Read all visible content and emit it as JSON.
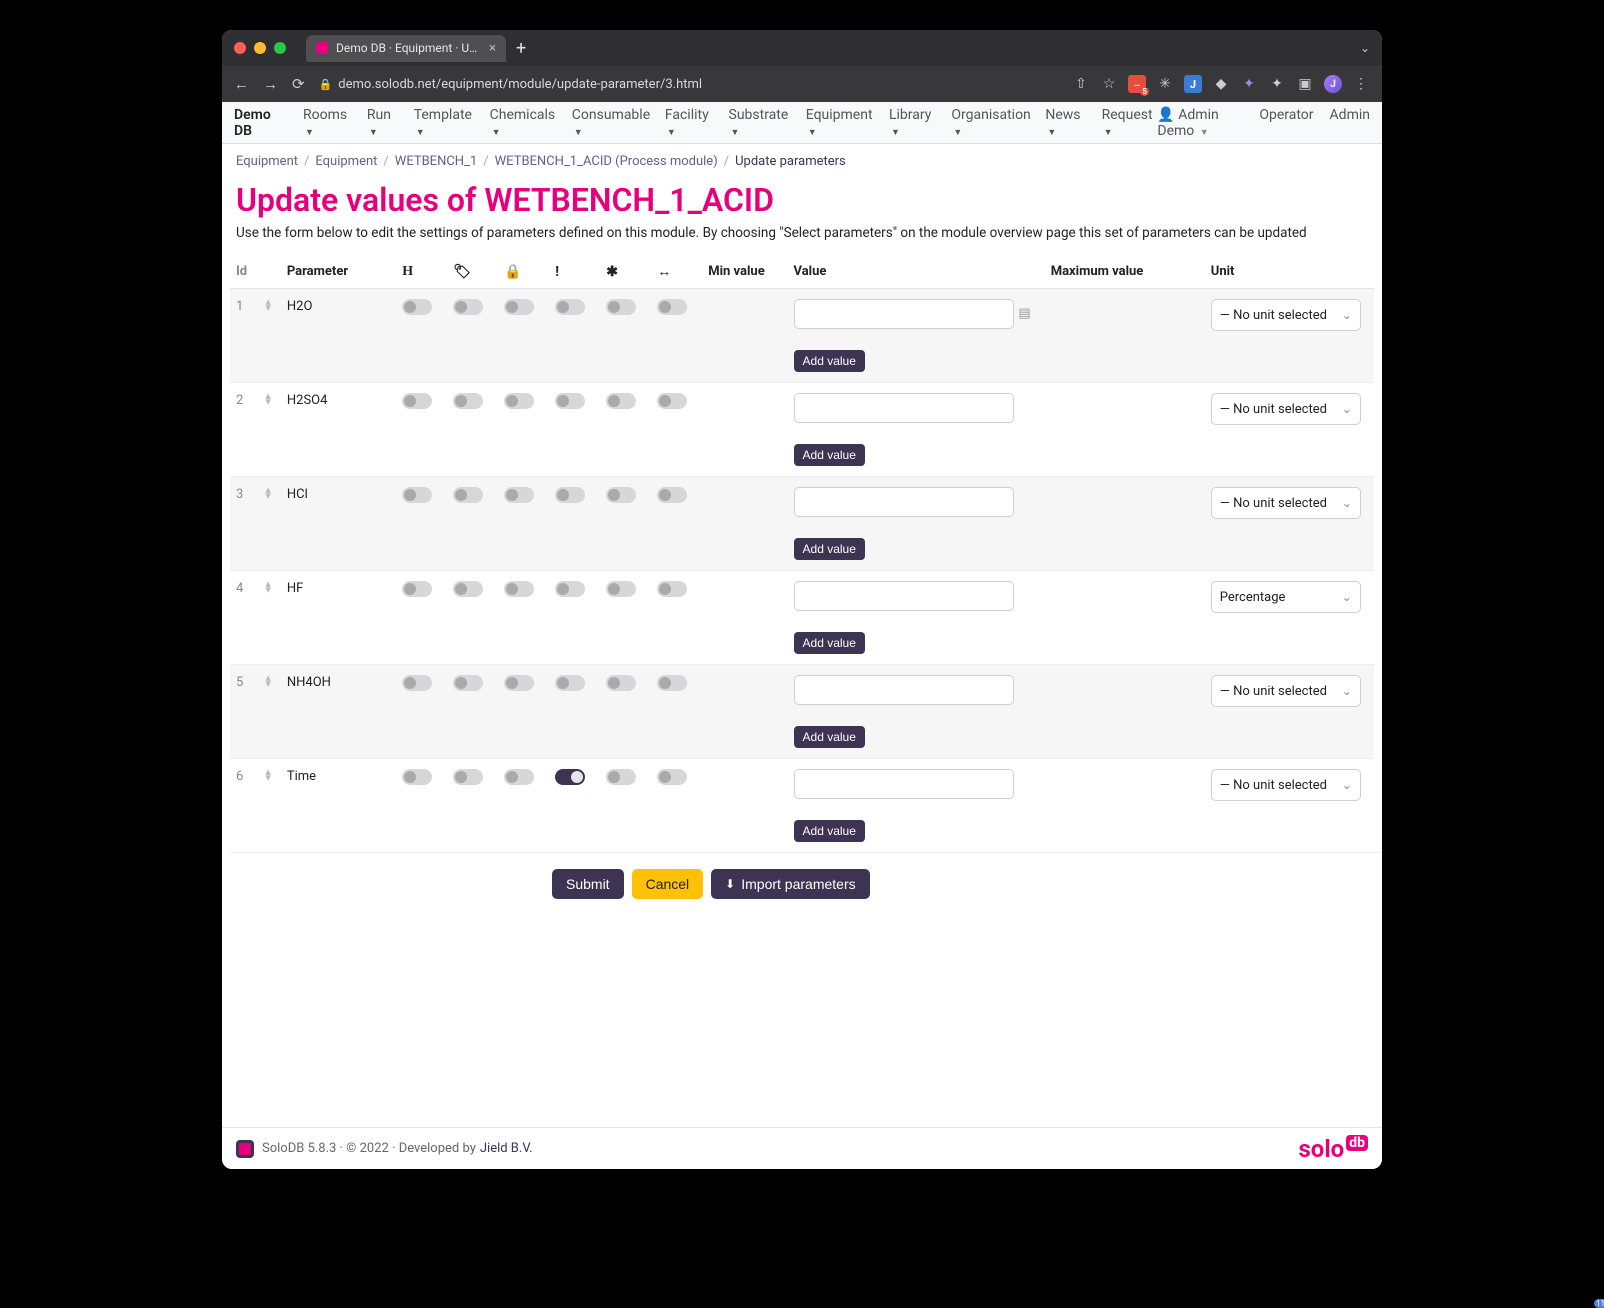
{
  "browser": {
    "tab_title": "Demo DB · Equipment · Update",
    "url": "demo.solodb.net/equipment/module/update-parameter/3.html"
  },
  "nav": {
    "brand": "Demo DB",
    "items": [
      "Rooms",
      "Run",
      "Template",
      "Chemicals",
      "Consumable",
      "Facility",
      "Substrate",
      "Equipment",
      "Library",
      "Organisation",
      "News",
      "Request"
    ],
    "user_label": "Admin Demo",
    "right_links": [
      "Operator",
      "Admin"
    ]
  },
  "breadcrumb": {
    "items": [
      "Equipment",
      "Equipment",
      "WETBENCH_1",
      "WETBENCH_1_ACID (Process module)",
      "Update parameters"
    ]
  },
  "page": {
    "title": "Update values of WETBENCH_1_ACID",
    "description": "Use the form below to edit the settings of parameters defined on this module. By choosing \"Select parameters\" on the module overview page this set of parameters can be updated"
  },
  "table": {
    "headers": {
      "id": "Id",
      "parameter": "Parameter",
      "min": "Min value",
      "value": "Value",
      "max": "Maximum value",
      "unit": "Unit"
    },
    "icon_cols": [
      "H",
      "tag",
      "lock",
      "!",
      "*",
      "range"
    ],
    "add_value_label": "Add value",
    "unit_placeholder": "— No unit selected",
    "rows": [
      {
        "id": "1",
        "name": "H2O",
        "toggles": [
          false,
          false,
          false,
          false,
          false,
          false
        ],
        "unit": "— No unit selected",
        "rich": true
      },
      {
        "id": "2",
        "name": "H2SO4",
        "toggles": [
          false,
          false,
          false,
          false,
          false,
          false
        ],
        "unit": "— No unit selected"
      },
      {
        "id": "3",
        "name": "HCl",
        "toggles": [
          false,
          false,
          false,
          false,
          false,
          false
        ],
        "unit": "— No unit selected"
      },
      {
        "id": "4",
        "name": "HF",
        "toggles": [
          false,
          false,
          false,
          false,
          false,
          false
        ],
        "unit": "Percentage"
      },
      {
        "id": "5",
        "name": "NH4OH",
        "toggles": [
          false,
          false,
          false,
          false,
          false,
          false
        ],
        "unit": "— No unit selected"
      },
      {
        "id": "6",
        "name": "Time",
        "toggles": [
          false,
          false,
          false,
          true,
          false,
          false
        ],
        "unit": "— No unit selected"
      }
    ]
  },
  "buttons": {
    "submit": "Submit",
    "cancel": "Cancel",
    "import": "Import parameters"
  },
  "footer": {
    "text": "SoloDB 5.8.3 · © 2022 · Developed by",
    "developer": "Jield B.V.",
    "brand_left": "solo",
    "brand_right": "db"
  }
}
